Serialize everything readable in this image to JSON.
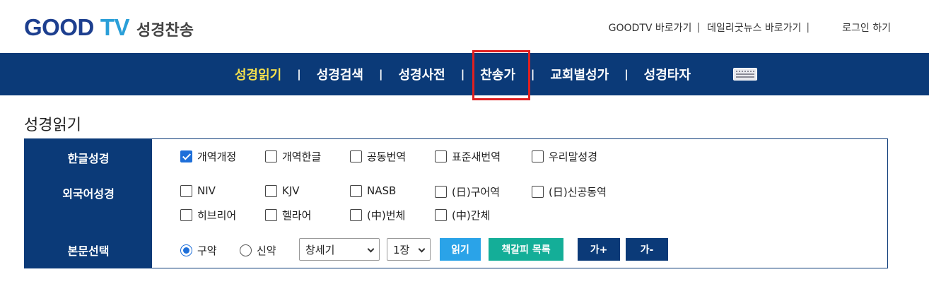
{
  "header": {
    "logo_good": "GOOD",
    "logo_tv": "TV",
    "logo_sub": "성경찬송",
    "links": [
      {
        "label": "GOODTV 바로가기"
      },
      {
        "label": "데일리굿뉴스 바로가기"
      }
    ],
    "separator": "|",
    "login_label": "로그인 하기"
  },
  "nav": {
    "items": [
      {
        "label": "성경읽기",
        "active": true
      },
      {
        "label": "성경검색"
      },
      {
        "label": "성경사전"
      },
      {
        "label": "찬송가",
        "highlighted": true
      },
      {
        "label": "교회별성가"
      },
      {
        "label": "성경타자"
      }
    ],
    "separator": "|",
    "keyboard_icon": "keyboard-icon"
  },
  "page": {
    "title": "성경읽기"
  },
  "form": {
    "korean_bible": {
      "label": "한글성경",
      "options": [
        {
          "label": "개역개정",
          "checked": true
        },
        {
          "label": "개역한글",
          "checked": false
        },
        {
          "label": "공동번역",
          "checked": false
        },
        {
          "label": "표준새번역",
          "checked": false
        },
        {
          "label": "우리말성경",
          "checked": false
        }
      ]
    },
    "foreign_bible": {
      "label": "외국어성경",
      "options": [
        {
          "label": "NIV",
          "checked": false
        },
        {
          "label": "KJV",
          "checked": false
        },
        {
          "label": "NASB",
          "checked": false
        },
        {
          "label": "(日)구어역",
          "checked": false
        },
        {
          "label": "(日)신공동역",
          "checked": false
        },
        {
          "label": "히브리어",
          "checked": false
        },
        {
          "label": "헬라어",
          "checked": false
        },
        {
          "label": "(中)번체",
          "checked": false
        },
        {
          "label": "(中)간체",
          "checked": false
        }
      ]
    },
    "text_select": {
      "label": "본문선택",
      "testament_options": [
        {
          "label": "구약",
          "checked": true
        },
        {
          "label": "신약",
          "checked": false
        }
      ],
      "book_value": "창세기",
      "chapter_value": "1장",
      "read_button": "읽기",
      "bookmark_button": "책갈피 목록",
      "font_increase_button": "가+",
      "font_decrease_button": "가-"
    }
  },
  "colors": {
    "navy": "#0b3a78",
    "nav_active": "#f4e04d",
    "highlight_border": "#e02020",
    "read_button": "#2aa3e8",
    "bookmark_button": "#14ae98",
    "checkbox_checked": "#1e6fd9"
  }
}
